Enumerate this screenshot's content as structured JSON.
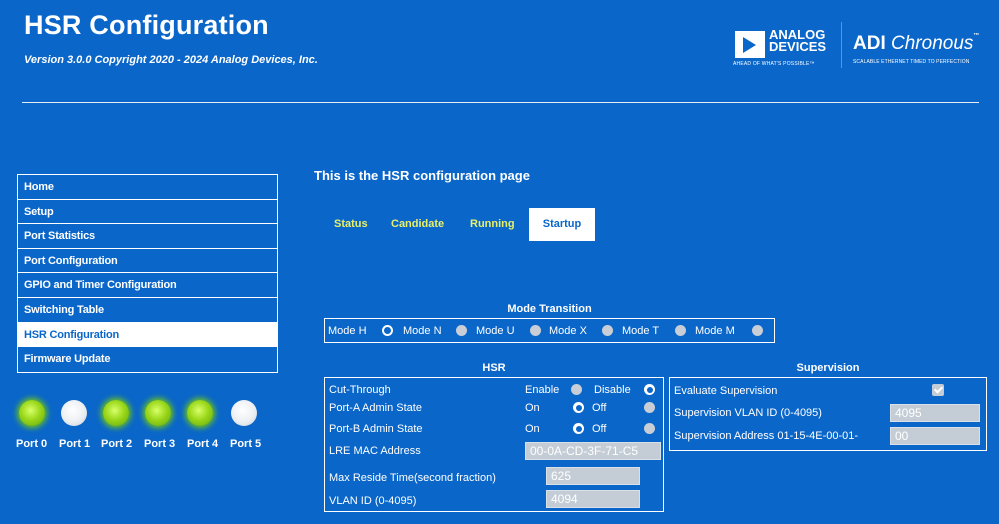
{
  "header": {
    "title": "HSR Configuration",
    "version": "Version 3.0.0 Copyright 2020 - 2024 Analog Devices, Inc."
  },
  "logos": {
    "adi_line1": "ANALOG",
    "adi_line2": "DEVICES",
    "adi_tagline": "AHEAD OF WHAT'S POSSIBLE™",
    "chronous_prefix": "ADI",
    "chronous_name": "Chronous",
    "chronous_tagline": "SCALABLE ETHERNET TIMED TO PERFECTION"
  },
  "nav": {
    "items": [
      {
        "label": "Home"
      },
      {
        "label": "Setup"
      },
      {
        "label": "Port Statistics"
      },
      {
        "label": "Port Configuration"
      },
      {
        "label": "GPIO and Timer Configuration"
      },
      {
        "label": "Switching Table"
      },
      {
        "label": "HSR Configuration"
      },
      {
        "label": "Firmware Update"
      }
    ],
    "active": "HSR Configuration"
  },
  "ports": [
    {
      "label": "Port 0",
      "state": "on"
    },
    {
      "label": "Port 1",
      "state": "off"
    },
    {
      "label": "Port 2",
      "state": "on"
    },
    {
      "label": "Port 3",
      "state": "on"
    },
    {
      "label": "Port 4",
      "state": "on"
    },
    {
      "label": "Port 5",
      "state": "off"
    }
  ],
  "main": {
    "heading": "This is the HSR configuration page",
    "tabs": [
      {
        "label": "Status"
      },
      {
        "label": "Candidate"
      },
      {
        "label": "Running"
      },
      {
        "label": "Startup"
      }
    ],
    "active_tab": "Startup"
  },
  "mode_transition": {
    "title": "Mode Transition",
    "modes": [
      {
        "label": "Mode H",
        "selected": true
      },
      {
        "label": "Mode N",
        "selected": false
      },
      {
        "label": "Mode U",
        "selected": false
      },
      {
        "label": "Mode X",
        "selected": false
      },
      {
        "label": "Mode T",
        "selected": false
      },
      {
        "label": "Mode M",
        "selected": false
      }
    ]
  },
  "hsr": {
    "title": "HSR",
    "cut_through": {
      "label": "Cut-Through",
      "opt1": "Enable",
      "opt2": "Disable",
      "selected": "Disable"
    },
    "port_a": {
      "label": "Port-A Admin State",
      "opt1": "On",
      "opt2": "Off",
      "selected": "On"
    },
    "port_b": {
      "label": "Port-B Admin State",
      "opt1": "On",
      "opt2": "Off",
      "selected": "On"
    },
    "lre_mac": {
      "label": "LRE MAC Address",
      "value": "00-0A-CD-3F-71-C5"
    },
    "max_reside": {
      "label": "Max Reside Time(second fraction)",
      "value": "625"
    },
    "vlan": {
      "label": "VLAN ID (0-4095)",
      "value": "4094"
    }
  },
  "supervision": {
    "title": "Supervision",
    "evaluate": {
      "label": "Evaluate Supervision",
      "checked": true
    },
    "vlan": {
      "label": "Supervision VLAN ID (0-4095)",
      "value": "4095"
    },
    "address": {
      "label": "Supervision Address 01-15-4E-00-01-",
      "value": "00"
    }
  },
  "colors": {
    "background": "#0a66c9",
    "tab_text": "#e8f06a",
    "led_on": "#9bd81a",
    "led_off": "#eceff2"
  }
}
